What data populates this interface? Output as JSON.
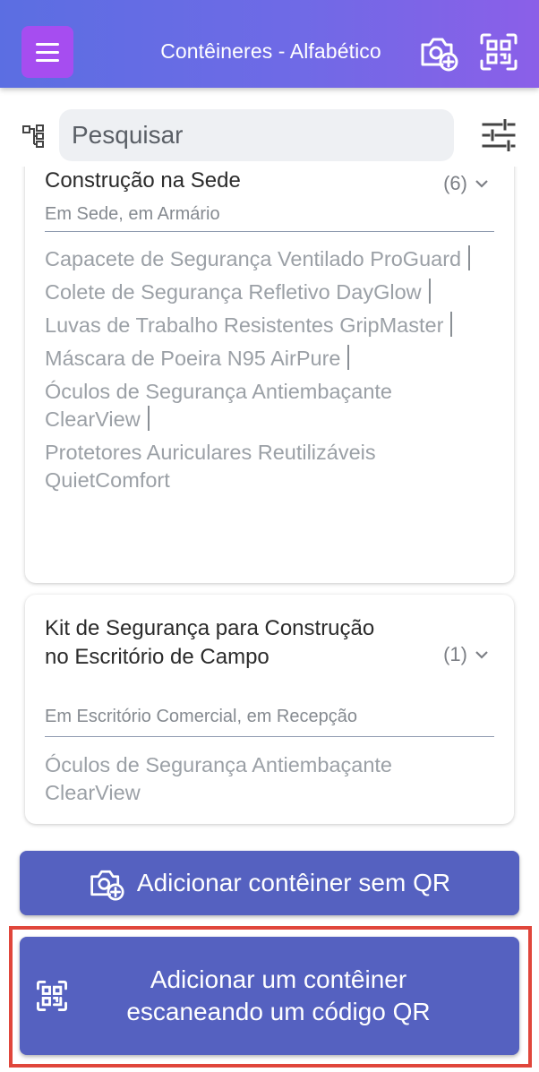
{
  "header": {
    "title": "Contêineres - Alfabético",
    "menu_icon": "hamburger-menu-icon",
    "add_photo_icon": "camera-add-icon",
    "scan_icon": "qr-scan-icon",
    "accent": "#a64df0"
  },
  "search": {
    "placeholder": "Pesquisar",
    "value": ""
  },
  "containers": [
    {
      "title": "Construção na Sede",
      "count": "(6)",
      "location": "Em Sede, em Armário",
      "items": [
        "Capacete de Segurança Ventilado ProGuard",
        "Colete de Segurança Refletivo DayGlow",
        "Luvas de Trabalho Resistentes GripMaster",
        "Máscara de Poeira N95 AirPure",
        "Óculos de Segurança Antiembaçante ClearView",
        "Protetores Auriculares Reutilizáveis QuietComfort"
      ]
    },
    {
      "title": "Kit de Segurança para Construção no Escritório de Campo",
      "count": "(1)",
      "location": "Em Escritório Comercial, em Recepção",
      "items": [
        "Óculos de Segurança Antiembaçante ClearView"
      ]
    }
  ],
  "buttons": {
    "add_without_qr": "Adicionar contêiner sem QR",
    "add_with_qr": "Adicionar um contêiner escaneando um código QR"
  },
  "colors": {
    "button": "#5561c0",
    "highlight": "#e0463b"
  }
}
